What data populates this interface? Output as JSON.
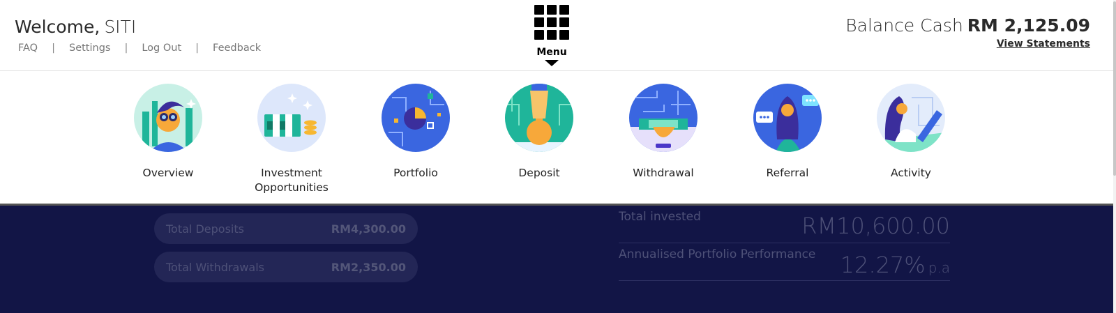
{
  "header": {
    "welcome_label": "Welcome,",
    "user_name": "SITI",
    "links": {
      "faq": "FAQ",
      "settings": "Settings",
      "logout": "Log Out",
      "feedback": "Feedback",
      "separator": "|"
    },
    "menu_label": "Menu",
    "balance_label": "Balance Cash",
    "balance_amount": "RM 2,125.09",
    "view_statements": "View Statements"
  },
  "menu": {
    "items": [
      {
        "label": "Overview",
        "icon": "overview-icon"
      },
      {
        "label": "Investment Opportunities",
        "icon": "investment-opportunities-icon"
      },
      {
        "label": "Portfolio",
        "icon": "portfolio-icon"
      },
      {
        "label": "Deposit",
        "icon": "deposit-icon"
      },
      {
        "label": "Withdrawal",
        "icon": "withdrawal-icon"
      },
      {
        "label": "Referral",
        "icon": "referral-icon"
      },
      {
        "label": "Activity",
        "icon": "activity-icon"
      }
    ]
  },
  "summary": {
    "total_deposits_label": "Total Deposits",
    "total_deposits_value": "RM4,300.00",
    "total_withdrawals_label": "Total Withdrawals",
    "total_withdrawals_value": "RM2,350.00",
    "total_invested_label": "Total invested",
    "total_invested_value": "RM10,600.00",
    "performance_label": "Annualised Portfolio Performance",
    "performance_value": "12.27%",
    "performance_unit": "p.a"
  },
  "colors": {
    "dark_background": "#121546",
    "accent_blue": "#3a66e0",
    "accent_teal": "#1fb59a",
    "accent_yellow": "#f7b731"
  }
}
